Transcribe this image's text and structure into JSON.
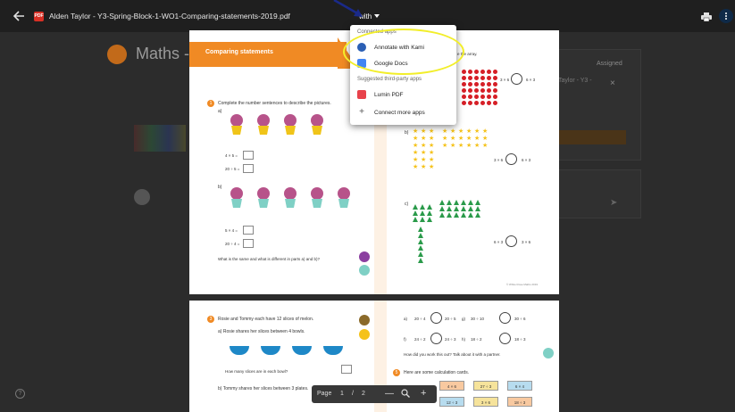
{
  "topbar": {
    "filename": "Alden Taylor - Y3-Spring-Block-1-WO1-Comparing-statements-2019.pdf",
    "pdf_icon_text": "PDF",
    "open_with_label": "with",
    "icons": [
      "back-arrow-icon",
      "print-icon",
      "more-vert-icon"
    ]
  },
  "dropdown": {
    "section_connected": "Connected apps",
    "items_connected": [
      {
        "label": "Annotate with Kami",
        "icon": "kami-icon",
        "color": "#2b5fb4"
      },
      {
        "label": "Google Docs",
        "icon": "google-docs-icon",
        "color": "#4285f4"
      }
    ],
    "section_suggested": "Suggested third-party apps",
    "items_suggested": [
      {
        "label": "Lumin PDF",
        "icon": "lumin-pdf-icon",
        "color": "#e8424b"
      },
      {
        "label": "Connect more apps",
        "icon": "plus-icon"
      }
    ]
  },
  "background": {
    "title": "Maths -",
    "assigned": "Assigned",
    "file": "Taylor - Y3 -",
    "close": "×"
  },
  "pdf": {
    "banner": "Comparing statements",
    "q1": "Complete the number sentences to describe the pictures.",
    "q1a": "a)",
    "q1b": "b)",
    "eq_a1": "4 × 5 =",
    "eq_a2": "20 ÷ 5 =",
    "eq_b1": "5 × 4 =",
    "eq_b2": "20 ÷ 4 =",
    "q1_footer": "What is the same and what is different in parts a) and b)?",
    "array_hint": "e the array.",
    "part_b": "b)",
    "part_c": "c)",
    "cmp_a": [
      "3 × 6",
      "6 × 3"
    ],
    "cmp_b": [
      "3 × 6",
      "6 × 3"
    ],
    "cmp_c": [
      "6 × 3",
      "3 × 6"
    ],
    "copyright": "© White Rose Maths 2019",
    "q3": "Rosie and Tommy each have 12 slices of melon.",
    "q3a": "a) Rosie shares her slices between 4 bowls.",
    "q3a_ask": "How many slices are in each bowl?",
    "q3b": "b) Tommy shares her slices between 3 plates.",
    "p2_row1": [
      "a)",
      "20 ÷ 4",
      "20 ÷ 5",
      "g)",
      "30 ÷ 10",
      "30 ÷ 6"
    ],
    "p2_row2": [
      "f)",
      "24 ÷ 2",
      "24 ÷ 3",
      "h)",
      "18 ÷ 2",
      "18 ÷ 3"
    ],
    "p2_talk": "How did you work this out? Talk about it with a partner.",
    "q5": "Here are some calculation cards.",
    "cards": [
      "4 × 6",
      "27 ÷ 3",
      "6 × 4",
      "12 ÷ 3",
      "3 × 6",
      "18 ÷ 3"
    ],
    "card_colors": [
      "#f8c9a0",
      "#f6e39b",
      "#b7dcef",
      "#b7dcef",
      "#f6e39b",
      "#f8c9a0"
    ]
  },
  "pagebar": {
    "label": "Page",
    "current": "1",
    "sep": "/",
    "total": "2",
    "minus": "—",
    "plus": "+"
  },
  "help": "?"
}
